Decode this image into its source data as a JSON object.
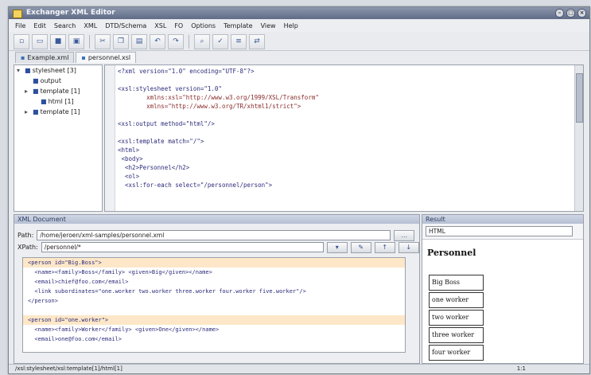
{
  "window": {
    "title": "Exchanger XML Editor"
  },
  "menu": [
    "File",
    "Edit",
    "Search",
    "XML",
    "DTD/Schema",
    "XSL",
    "FO",
    "Options",
    "Template",
    "View",
    "Help"
  ],
  "toolbar": {
    "icons": [
      "new-icon",
      "open-icon",
      "save-icon",
      "save-all-icon",
      "cut-icon",
      "copy-icon",
      "paste-icon",
      "undo-icon",
      "redo-icon",
      "find-icon",
      "validate-icon",
      "format-icon",
      "transform-icon"
    ]
  },
  "tabs": [
    {
      "label": "Example.xml"
    },
    {
      "label": "personnel.xsl"
    }
  ],
  "tree": [
    {
      "label": "stylesheet [3]",
      "indent": 0
    },
    {
      "label": "output",
      "indent": 1
    },
    {
      "label": "template [1]",
      "indent": 1
    },
    {
      "label": "html [1]",
      "indent": 2
    },
    {
      "label": "template [1]",
      "indent": 1
    }
  ],
  "editor": {
    "lines": [
      {
        "text": "<?xml version=\"1.0\" encoding=\"UTF-8\"?>",
        "kind": "tag"
      },
      {
        "text": "",
        "kind": "tag"
      },
      {
        "text": "<xsl:stylesheet version=\"1.0\"",
        "kind": "tag"
      },
      {
        "text": "        xmlns:xsl=\"http://www.w3.org/1999/XSL/Transform\"",
        "kind": "attr"
      },
      {
        "text": "        xmlns=\"http://www.w3.org/TR/xhtml1/strict\">",
        "kind": "attr"
      },
      {
        "text": "",
        "kind": "tag"
      },
      {
        "text": "<xsl:output method=\"html\"/>",
        "kind": "tag"
      },
      {
        "text": "",
        "kind": "tag"
      },
      {
        "text": "<xsl:template match=\"/\">",
        "kind": "tag"
      },
      {
        "text": "<html>",
        "kind": "tag"
      },
      {
        "text": " <body>",
        "kind": "tag"
      },
      {
        "text": "  <h2>Personnel</h2>",
        "kind": "tag"
      },
      {
        "text": "  <ol>",
        "kind": "tag"
      },
      {
        "text": "  <xsl:for-each select=\"/personnel/person\">",
        "kind": "tag"
      }
    ]
  },
  "xml_panel": {
    "title": "XML Document",
    "path_label": "Path:",
    "path_value": "/home/jeroen/xml-samples/personnel.xml",
    "xpath_label": "XPath:",
    "xpath_value": "/personnel/*",
    "lines": [
      {
        "text": "<person id=\"Big.Boss\">",
        "sel": true
      },
      {
        "text": "  <name><family>Boss</family> <given>Big</given></name>",
        "sel": false
      },
      {
        "text": "  <email>chief@foo.com</email>",
        "sel": false
      },
      {
        "text": "  <link subordinates=\"one.worker two.worker three.worker four.worker five.worker\"/>",
        "sel": false
      },
      {
        "text": "</person>",
        "sel": false
      },
      {
        "text": "",
        "sel": false
      },
      {
        "text": "<person id=\"one.worker\">",
        "sel": true
      },
      {
        "text": "  <name><family>Worker</family> <given>One</given></name>",
        "sel": false
      },
      {
        "text": "  <email>one@foo.com</email>",
        "sel": false
      }
    ]
  },
  "result_panel": {
    "title": "Result",
    "format": "HTML",
    "heading": "Personnel",
    "items": [
      "Big Boss",
      "one worker",
      "two worker",
      "three worker",
      "four worker"
    ]
  },
  "status": {
    "text": "/xsl:stylesheet/xsl:template[1]/html[1]",
    "position": "1:1"
  }
}
